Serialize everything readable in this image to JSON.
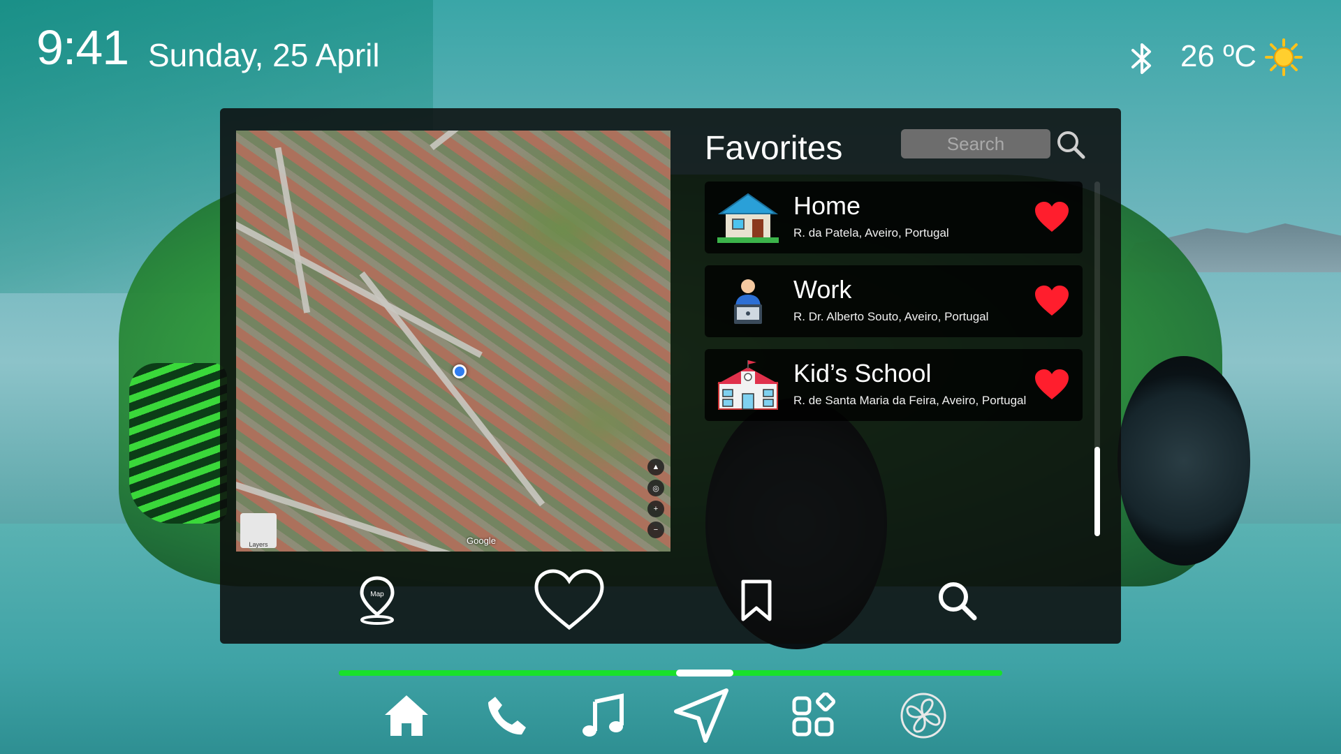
{
  "status_bar": {
    "time": "9:41",
    "date": "Sunday, 25 April",
    "temperature": "26 ºC",
    "bluetooth_icon": "bluetooth-icon",
    "weather_icon": "sun-icon"
  },
  "map": {
    "attribution": "Google",
    "layers_label": "Layers"
  },
  "favorites": {
    "title": "Favorites",
    "search_placeholder": "Search",
    "items": [
      {
        "name": "Home",
        "address": "R. da Patela, Aveiro, Portugal",
        "icon": "house-icon"
      },
      {
        "name": "Work",
        "address": "R. Dr. Alberto Souto, Aveiro, Portugal",
        "icon": "office-worker-icon"
      },
      {
        "name": "Kid’s School",
        "address": "R. de Santa Maria da Feira, Aveiro, Portugal",
        "icon": "school-icon"
      }
    ],
    "favorite_color": "#ff1e2d"
  },
  "panel_nav": {
    "items": [
      {
        "icon": "map-pin-icon",
        "label": "Map"
      },
      {
        "icon": "heart-outline-icon"
      },
      {
        "icon": "bookmark-icon"
      },
      {
        "icon": "search-icon"
      }
    ]
  },
  "dock": {
    "items": [
      "home-icon",
      "phone-icon",
      "music-icon",
      "navigation-icon",
      "apps-icon",
      "fan-icon"
    ],
    "accent": "#19e02b"
  }
}
